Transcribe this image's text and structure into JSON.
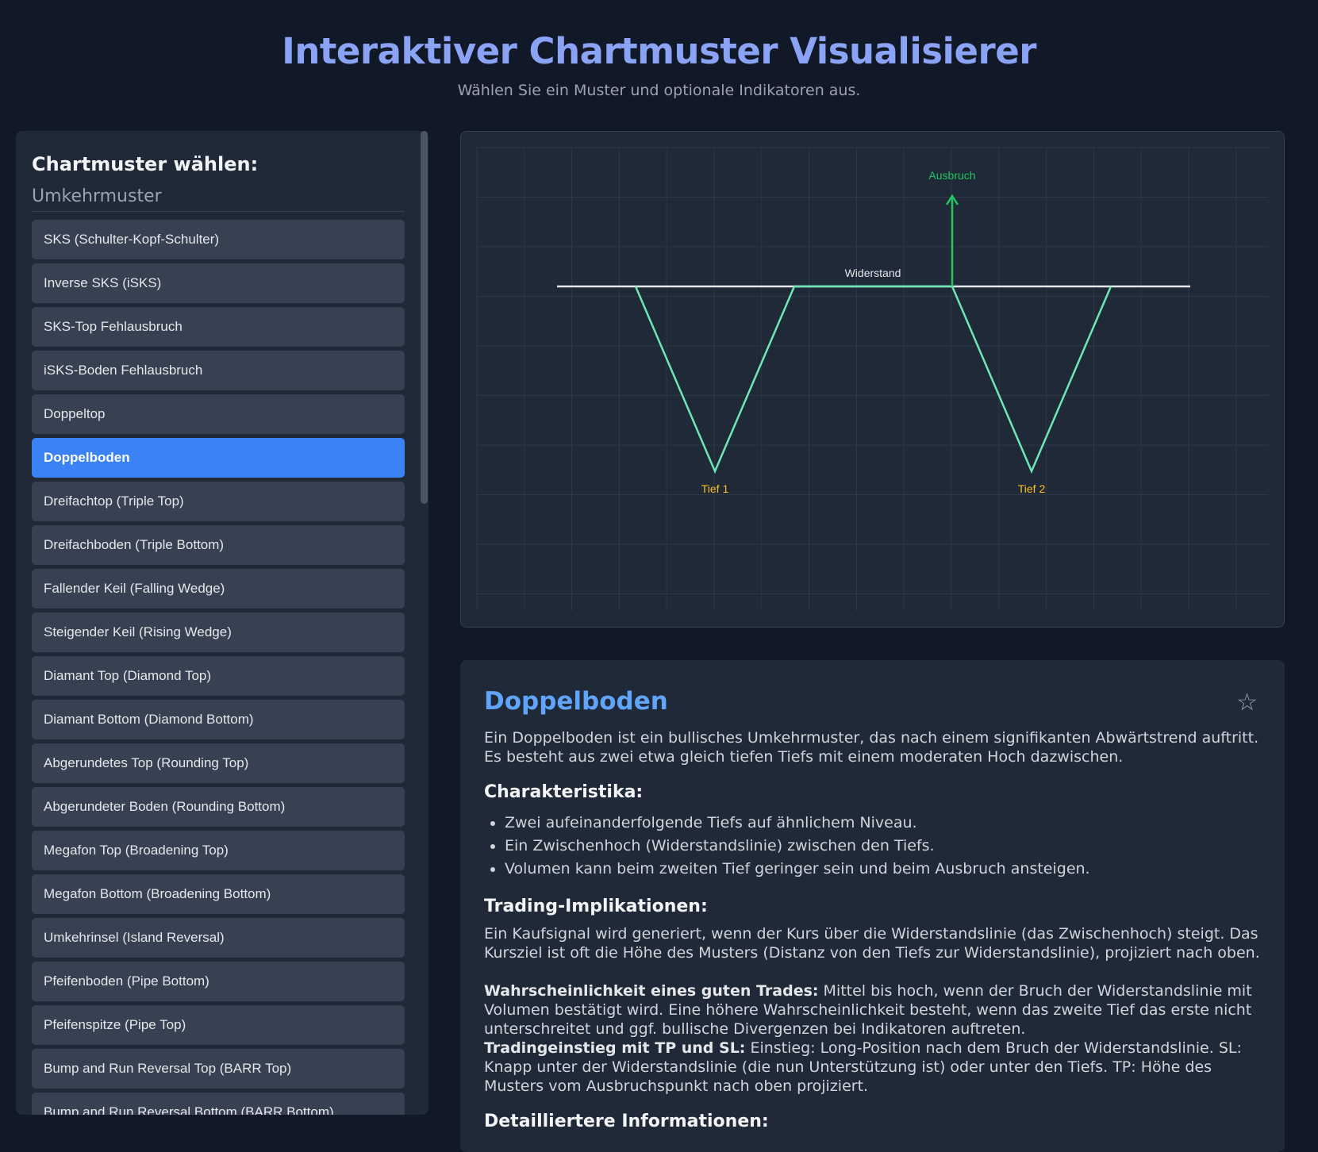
{
  "header": {
    "title": "Interaktiver Chartmuster Visualisierer",
    "subtitle": "Wählen Sie ein Muster und optionale Indikatoren aus."
  },
  "sidebar": {
    "title": "Chartmuster wählen:",
    "group": "Umkehrmuster",
    "items": [
      {
        "label": "SKS (Schulter-Kopf-Schulter)"
      },
      {
        "label": "Inverse SKS (iSKS)"
      },
      {
        "label": "SKS-Top Fehlausbruch"
      },
      {
        "label": "iSKS-Boden Fehlausbruch"
      },
      {
        "label": "Doppeltop"
      },
      {
        "label": "Doppelboden"
      },
      {
        "label": "Dreifachtop (Triple Top)"
      },
      {
        "label": "Dreifachboden (Triple Bottom)"
      },
      {
        "label": "Fallender Keil (Falling Wedge)"
      },
      {
        "label": "Steigender Keil (Rising Wedge)"
      },
      {
        "label": "Diamant Top (Diamond Top)"
      },
      {
        "label": "Diamant Bottom (Diamond Bottom)"
      },
      {
        "label": "Abgerundetes Top (Rounding Top)"
      },
      {
        "label": "Abgerundeter Boden (Rounding Bottom)"
      },
      {
        "label": "Megafon Top (Broadening Top)"
      },
      {
        "label": "Megafon Bottom (Broadening Bottom)"
      },
      {
        "label": "Umkehrinsel (Island Reversal)"
      },
      {
        "label": "Pfeifenboden (Pipe Bottom)"
      },
      {
        "label": "Pfeifenspitze (Pipe Top)"
      },
      {
        "label": "Bump and Run Reversal Top (BARR Top)"
      },
      {
        "label": "Bump and Run Reversal Bottom (BARR Bottom)"
      }
    ],
    "active_index": 5
  },
  "chart": {
    "label_breakout": "Ausbruch",
    "label_resistance": "Widerstand",
    "label_low1": "Tief 1",
    "label_low2": "Tief 2",
    "colors": {
      "pattern": "#6ee7b7",
      "breakout": "#22c55e",
      "resistance": "#e5e7eb",
      "lows": "#fbbf24"
    }
  },
  "info": {
    "title": "Doppelboden",
    "star_icon": "☆",
    "description": "Ein Doppelboden ist ein bullisches Umkehrmuster, das nach einem signifikanten Abwärtstrend auftritt. Es besteht aus zwei etwa gleich tiefen Tiefs mit einem moderaten Hoch dazwischen.",
    "characteristics_title": "Charakteristika:",
    "characteristics": [
      "Zwei aufeinanderfolgende Tiefs auf ähnlichem Niveau.",
      "Ein Zwischenhoch (Widerstandslinie) zwischen den Tiefs.",
      "Volumen kann beim zweiten Tief geringer sein und beim Ausbruch ansteigen."
    ],
    "trading_title": "Trading-Implikationen:",
    "trading_text": "Ein Kaufsignal wird generiert, wenn der Kurs über die Widerstandslinie (das Zwischenhoch) steigt. Das Kursziel ist oft die Höhe des Musters (Distanz von den Tiefs zur Widerstandslinie), projiziert nach oben.",
    "probability_label": "Wahrscheinlichkeit eines guten Trades:",
    "probability_text": "Mittel bis hoch, wenn der Bruch der Widerstandslinie mit Volumen bestätigt wird. Eine höhere Wahrscheinlichkeit besteht, wenn das zweite Tief das erste nicht unterschreitet und ggf. bullische Divergenzen bei Indikatoren auftreten.",
    "entry_label": "Tradingeinstieg mit TP und SL:",
    "entry_text": "Einstieg: Long-Position nach dem Bruch der Widerstandslinie. SL: Knapp unter der Widerstandslinie (die nun Unterstützung ist) oder unter den Tiefs. TP: Höhe des Musters vom Ausbruchspunkt nach oben projiziert.",
    "details_title": "Detailliertere Informationen:"
  }
}
